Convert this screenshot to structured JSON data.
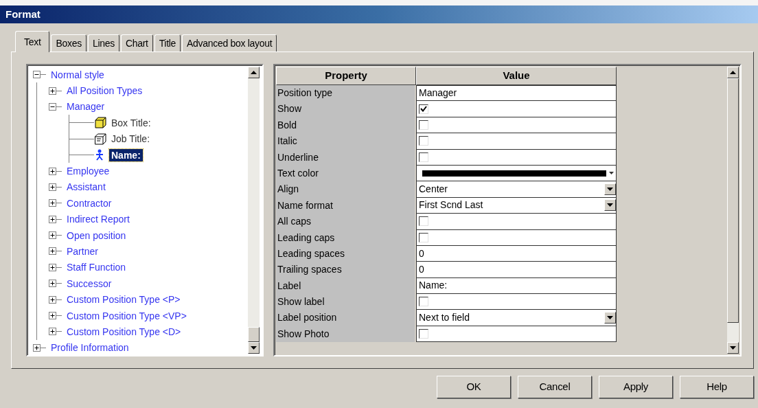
{
  "window": {
    "title": "Format"
  },
  "tabs": [
    {
      "label": "Text",
      "selected": true
    },
    {
      "label": "Boxes",
      "selected": false
    },
    {
      "label": "Lines",
      "selected": false
    },
    {
      "label": "Chart",
      "selected": false
    },
    {
      "label": "Title",
      "selected": false
    },
    {
      "label": "Advanced box layout",
      "selected": false
    }
  ],
  "tree": [
    {
      "label": "Normal style",
      "expanded": true,
      "selected": false,
      "children": [
        {
          "label": "All Position Types",
          "expanded": false,
          "selected": false
        },
        {
          "label": "Manager",
          "expanded": true,
          "selected": false,
          "children": [
            {
              "label": "Box Title:",
              "kind": "box",
              "selected": false
            },
            {
              "label": "Job Title:",
              "kind": "outline",
              "selected": false
            },
            {
              "label": "Name:",
              "kind": "person",
              "selected": true
            }
          ]
        },
        {
          "label": "Employee",
          "expanded": false,
          "selected": false
        },
        {
          "label": "Assistant",
          "expanded": false,
          "selected": false
        },
        {
          "label": "Contractor",
          "expanded": false,
          "selected": false
        },
        {
          "label": "Indirect Report",
          "expanded": false,
          "selected": false
        },
        {
          "label": "Open position",
          "expanded": false,
          "selected": false
        },
        {
          "label": "Partner",
          "expanded": false,
          "selected": false
        },
        {
          "label": "Staff Function",
          "expanded": false,
          "selected": false
        },
        {
          "label": "Successor",
          "expanded": false,
          "selected": false
        },
        {
          "label": "Custom Position Type <P>",
          "expanded": false,
          "selected": false
        },
        {
          "label": "Custom Position Type <VP>",
          "expanded": false,
          "selected": false
        },
        {
          "label": "Custom Position Type <D>",
          "expanded": false,
          "selected": false
        }
      ]
    },
    {
      "label": "Profile Information",
      "expanded": false,
      "selected": false
    }
  ],
  "grid": {
    "columns": [
      "Property",
      "Value"
    ],
    "rows": [
      {
        "name": "Position type",
        "kind": "text",
        "value": "Manager"
      },
      {
        "name": "Show",
        "kind": "checkbox",
        "checked": true
      },
      {
        "name": "Bold",
        "kind": "checkbox",
        "checked": false
      },
      {
        "name": "Italic",
        "kind": "checkbox",
        "checked": false
      },
      {
        "name": "Underline",
        "kind": "checkbox",
        "checked": false
      },
      {
        "name": "Text color",
        "kind": "color",
        "color": "#000000"
      },
      {
        "name": "Align",
        "kind": "dropdown",
        "value": "Center"
      },
      {
        "name": "Name format",
        "kind": "dropdown",
        "value": "First Scnd Last"
      },
      {
        "name": "All caps",
        "kind": "checkbox",
        "checked": false
      },
      {
        "name": "Leading caps",
        "kind": "checkbox",
        "checked": false
      },
      {
        "name": "Leading spaces",
        "kind": "text",
        "value": "0"
      },
      {
        "name": "Trailing spaces",
        "kind": "text",
        "value": "0"
      },
      {
        "name": "Label",
        "kind": "text",
        "value": "Name:"
      },
      {
        "name": "Show label",
        "kind": "checkbox",
        "checked": false
      },
      {
        "name": "Label position",
        "kind": "dropdown",
        "value": "Next to field"
      },
      {
        "name": "Show Photo",
        "kind": "checkbox",
        "checked": false
      }
    ]
  },
  "buttons": [
    "OK",
    "Cancel",
    "Apply",
    "Help"
  ]
}
